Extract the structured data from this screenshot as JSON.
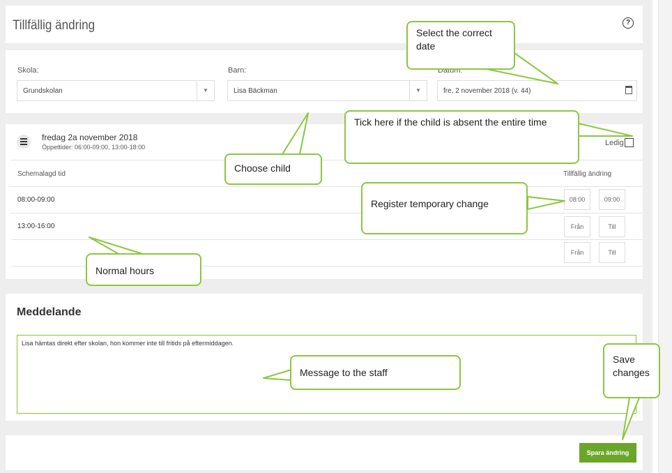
{
  "header": {
    "title": "Tillfällig ändring",
    "help_icon": "?"
  },
  "filters": {
    "school_label": "Skola:",
    "school_value": "Grundskolan",
    "child_label": "Barn:",
    "child_value": "Lisa Bäckman",
    "date_label": "Datum:",
    "date_value": "fre, 2 november 2018 (v. 44)"
  },
  "day": {
    "title": "fredag 2a november 2018",
    "opening_hours": "Öppettider: 06:00-09:00, 13:00-18:00",
    "ledig_label": "Ledig"
  },
  "schedule": {
    "scheduled_header": "Schemalagd tid",
    "change_header": "Tillfällig ändring",
    "rows": [
      {
        "time": "08:00-09:00",
        "from": "08:00",
        "to": "09:00"
      },
      {
        "time": "13:00-16:00",
        "from": "Från",
        "to": "Till"
      },
      {
        "time": "",
        "from": "Från",
        "to": "Till"
      }
    ]
  },
  "message": {
    "title": "Meddelande",
    "text": "Lisa hämtas direkt efter skolan, hon kommer inte till fritids på eftermiddagen."
  },
  "save_button": "Spara ändring",
  "callouts": {
    "date": "Select the correct date",
    "child": "Choose child",
    "absent": "Tick here if the child is absent the entire time",
    "change": "Register temporary change",
    "normal": "Normal hours",
    "message": "Message to the staff",
    "save": "Save changes"
  },
  "colors": {
    "accent": "#6aa629",
    "callout_border": "#8cc63f",
    "background": "#eeeeee"
  }
}
